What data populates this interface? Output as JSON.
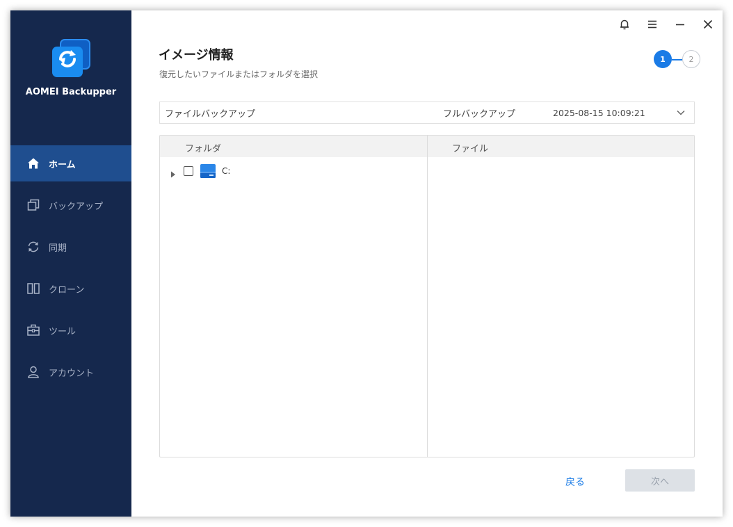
{
  "app": {
    "name": "AOMEI Backupper",
    "accent_color": "#1a7be6",
    "sidebar_color": "#15284d"
  },
  "sidebar": {
    "items": [
      {
        "label": "ホーム",
        "icon": "home-icon",
        "active": true
      },
      {
        "label": "バックアップ",
        "icon": "backup-icon",
        "active": false
      },
      {
        "label": "同期",
        "icon": "sync-icon",
        "active": false
      },
      {
        "label": "クローン",
        "icon": "clone-icon",
        "active": false
      },
      {
        "label": "ツール",
        "icon": "toolbox-icon",
        "active": false
      },
      {
        "label": "アカウント",
        "icon": "account-icon",
        "active": false
      }
    ]
  },
  "topbar": {
    "icons": [
      "bell-icon",
      "menu-icon",
      "minimize-icon",
      "close-icon"
    ]
  },
  "page": {
    "title": "イメージ情報",
    "subtitle": "復元したいファイルまたはフォルダを選択"
  },
  "steps": {
    "current": 1,
    "labels": [
      "1",
      "2"
    ]
  },
  "backup_select": {
    "name": "ファイルバックアップ",
    "type": "フルバックアップ",
    "date": "2025-08-15 10:09:21"
  },
  "browser": {
    "folder_header": "フォルダ",
    "file_header": "ファイル",
    "tree": [
      {
        "label": "C:",
        "checked": false,
        "expanded": false,
        "icon": "drive-icon"
      }
    ]
  },
  "buttons": {
    "back": "戻る",
    "next": "次へ"
  }
}
